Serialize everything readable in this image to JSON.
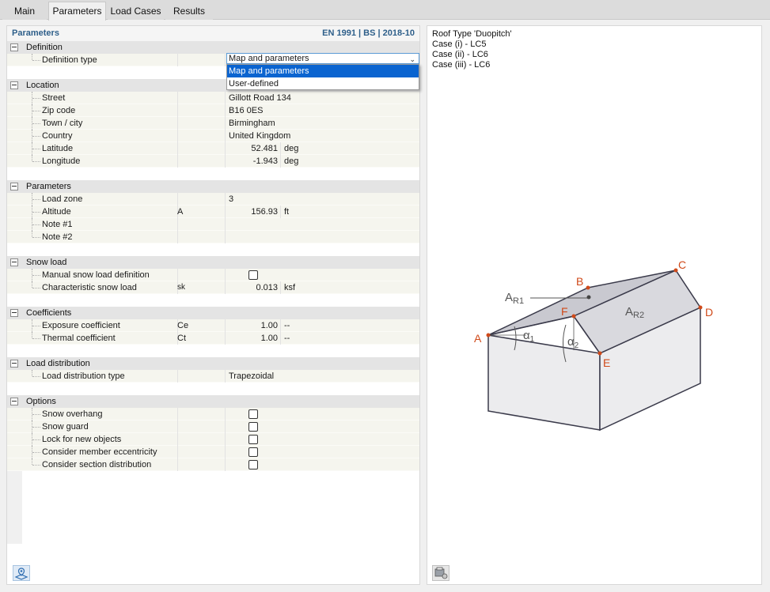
{
  "tabs": [
    {
      "label": "Main",
      "active": false
    },
    {
      "label": "Parameters",
      "active": true
    },
    {
      "label": "Load Cases",
      "active": false
    },
    {
      "label": "Results",
      "active": false
    }
  ],
  "panel": {
    "title": "Parameters",
    "standard": "EN 1991 | BS | 2018-10"
  },
  "groups": {
    "definition": {
      "label": "Definition",
      "definition_type": {
        "label": "Definition type",
        "value": "Map and parameters"
      },
      "dropdown_options": [
        "Map and parameters",
        "User-defined"
      ]
    },
    "location": {
      "label": "Location",
      "street": {
        "label": "Street",
        "value": "Gillott Road 134"
      },
      "zip": {
        "label": "Zip code",
        "value": "B16 0ES"
      },
      "town": {
        "label": "Town / city",
        "value": "Birmingham"
      },
      "country": {
        "label": "Country",
        "value": "United Kingdom"
      },
      "latitude": {
        "label": "Latitude",
        "value": "52.481",
        "unit": "deg"
      },
      "longitude": {
        "label": "Longitude",
        "value": "-1.943",
        "unit": "deg"
      }
    },
    "parameters": {
      "label": "Parameters",
      "load_zone": {
        "label": "Load zone",
        "value": "3"
      },
      "altitude": {
        "label": "Altitude",
        "symbol": "A",
        "value": "156.93",
        "unit": "ft"
      },
      "note1": {
        "label": "Note #1"
      },
      "note2": {
        "label": "Note #2"
      }
    },
    "snow_load": {
      "label": "Snow load",
      "manual": {
        "label": "Manual snow load definition",
        "checked": false
      },
      "characteristic": {
        "label": "Characteristic snow load",
        "symbol": "sk",
        "value": "0.013",
        "unit": "ksf"
      }
    },
    "coefficients": {
      "label": "Coefficients",
      "exposure": {
        "label": "Exposure coefficient",
        "symbol": "Ce",
        "value": "1.00",
        "unit": "--"
      },
      "thermal": {
        "label": "Thermal coefficient",
        "symbol": "Ct",
        "value": "1.00",
        "unit": "--"
      }
    },
    "load_distribution": {
      "label": "Load distribution",
      "type": {
        "label": "Load distribution type",
        "value": "Trapezoidal"
      }
    },
    "options": {
      "label": "Options",
      "snow_overhang": {
        "label": "Snow overhang",
        "checked": false
      },
      "snow_guard": {
        "label": "Snow guard",
        "checked": false
      },
      "lock_new": {
        "label": "Lock for new objects",
        "checked": false
      },
      "member_ecc": {
        "label": "Consider member eccentricity",
        "checked": false
      },
      "section_dist": {
        "label": "Consider section distribution",
        "checked": false
      }
    }
  },
  "info": {
    "roof_type": "Roof Type 'Duopitch'",
    "case1": "Case (i) - LC5",
    "case2": "Case (ii) - LC6",
    "case3": "Case (iii) - LC6"
  },
  "diagram": {
    "points": [
      "A",
      "B",
      "C",
      "D",
      "E",
      "F"
    ],
    "area1": "A",
    "area1_sub": "R1",
    "area2": "A",
    "area2_sub": "R2",
    "alpha": "α",
    "alpha1_sub": "1",
    "alpha2_sub": "2",
    "accent_color": "#d04a1a"
  }
}
